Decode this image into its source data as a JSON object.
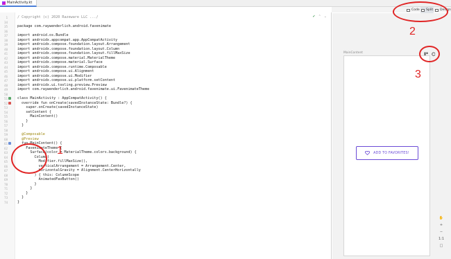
{
  "tab": {
    "filename": "MainActivity.kt"
  },
  "view_switch": {
    "code": "Code",
    "split": "Split",
    "design": "Design"
  },
  "code_lines": [
    {
      "n": "1",
      "t": "/ Copyright (c) 2020 Razeware LLC .../",
      "c": "#8c8c8c",
      "i": ""
    },
    {
      "n": "34",
      "t": "",
      "c": "#1f1f1f",
      "i": ""
    },
    {
      "n": "35",
      "t": "package com.raywenderlich.android.favenimate",
      "c": "#1f1f1f",
      "i": ""
    },
    {
      "n": "36",
      "t": "",
      "c": "#1f1f1f",
      "i": ""
    },
    {
      "n": "37",
      "t": "import android.os.Bundle",
      "c": "#1f1f1f",
      "i": ""
    },
    {
      "n": "38",
      "t": "import androidx.appcompat.app.AppCompatActivity",
      "c": "#1f1f1f",
      "i": ""
    },
    {
      "n": "39",
      "t": "import androidx.compose.foundation.layout.Arrangement",
      "c": "#1f1f1f",
      "i": ""
    },
    {
      "n": "40",
      "t": "import androidx.compose.foundation.layout.Column",
      "c": "#1f1f1f",
      "i": ""
    },
    {
      "n": "41",
      "t": "import androidx.compose.foundation.layout.fillMaxSize",
      "c": "#1f1f1f",
      "i": ""
    },
    {
      "n": "42",
      "t": "import androidx.compose.material.MaterialTheme",
      "c": "#1f1f1f",
      "i": ""
    },
    {
      "n": "43",
      "t": "import androidx.compose.material.Surface",
      "c": "#1f1f1f",
      "i": ""
    },
    {
      "n": "44",
      "t": "import androidx.compose.runtime.Composable",
      "c": "#1f1f1f",
      "i": ""
    },
    {
      "n": "45",
      "t": "import androidx.compose.ui.Alignment",
      "c": "#1f1f1f",
      "i": ""
    },
    {
      "n": "46",
      "t": "import androidx.compose.ui.Modifier",
      "c": "#1f1f1f",
      "i": ""
    },
    {
      "n": "47",
      "t": "import androidx.compose.ui.platform.setContent",
      "c": "#1f1f1f",
      "i": ""
    },
    {
      "n": "48",
      "t": "import androidx.ui.tooling.preview.Preview",
      "c": "#1f1f1f",
      "i": ""
    },
    {
      "n": "49",
      "t": "import com.raywenderlich.android.favenimate.ui.FavenimateTheme",
      "c": "#1f1f1f",
      "i": ""
    },
    {
      "n": "50",
      "t": "",
      "c": "#1f1f1f",
      "i": ""
    },
    {
      "n": "51",
      "t": "class MainActivity : AppCompatActivity() {",
      "c": "#1f1f1f",
      "i": "run"
    },
    {
      "n": "52",
      "t": "  override fun onCreate(savedInstanceState: Bundle?) {",
      "c": "#1f1f1f",
      "i": "override"
    },
    {
      "n": "53",
      "t": "    super.onCreate(savedInstanceState)",
      "c": "#1f1f1f",
      "i": ""
    },
    {
      "n": "54",
      "t": "    setContent {",
      "c": "#1f1f1f",
      "i": ""
    },
    {
      "n": "55",
      "t": "      MainContent()",
      "c": "#1f1f1f",
      "i": ""
    },
    {
      "n": "56",
      "t": "    }",
      "c": "#1f1f1f",
      "i": ""
    },
    {
      "n": "57",
      "t": "  }",
      "c": "#1f1f1f",
      "i": ""
    },
    {
      "n": "58",
      "t": "",
      "c": "#1f1f1f",
      "i": ""
    },
    {
      "n": "59",
      "t": "  @Composable",
      "c": "#9e880d",
      "i": ""
    },
    {
      "n": "60",
      "t": "  @Preview",
      "c": "#9e880d",
      "i": ""
    },
    {
      "n": "61",
      "t": "  fun MainContent() {",
      "c": "#1f1f1f",
      "i": "preview"
    },
    {
      "n": "62",
      "t": "    FavenimateTheme {",
      "c": "#1f1f1f",
      "i": ""
    },
    {
      "n": "63",
      "t": "      Surface(color = MaterialTheme.colors.background) {",
      "c": "#1f1f1f",
      "i": ""
    },
    {
      "n": "64",
      "t": "        Column(",
      "c": "#1f1f1f",
      "i": ""
    },
    {
      "n": "65",
      "t": "          Modifier.fillMaxSize(),",
      "c": "#1f1f1f",
      "i": ""
    },
    {
      "n": "66",
      "t": "          verticalArrangement = Arrangement.Center,",
      "c": "#1f1f1f",
      "i": ""
    },
    {
      "n": "67",
      "t": "          horizontalGravity = Alignment.CenterHorizontally",
      "c": "#1f1f1f",
      "i": ""
    },
    {
      "n": "68",
      "t": "        ) { this: ColumnScope",
      "c": "#1f1f1f",
      "i": ""
    },
    {
      "n": "69",
      "t": "          AnimatedFavButton()",
      "c": "#1f1f1f",
      "i": ""
    },
    {
      "n": "70",
      "t": "        }",
      "c": "#1f1f1f",
      "i": ""
    },
    {
      "n": "71",
      "t": "      }",
      "c": "#1f1f1f",
      "i": ""
    },
    {
      "n": "72",
      "t": "    }",
      "c": "#1f1f1f",
      "i": ""
    },
    {
      "n": "73",
      "t": "  }",
      "c": "#1f1f1f",
      "i": ""
    },
    {
      "n": "74",
      "t": "}",
      "c": "#1f1f1f",
      "i": ""
    }
  ],
  "preview": {
    "title": "MainContent",
    "button_label": "ADD TO FAVORITES!"
  },
  "side_tools": [
    "+",
    "−",
    "1:1",
    "□"
  ],
  "annotations": [
    "1",
    "2",
    "3"
  ],
  "colors": {
    "accent": "#6a4ad6",
    "annotation": "#e02424",
    "tab_underline": "#4a7fd8"
  },
  "icons": {
    "tab": "kotlin-file-icon",
    "code_view": "code-view-icon",
    "split_view": "split-view-icon",
    "design_view": "design-view-icon"
  }
}
